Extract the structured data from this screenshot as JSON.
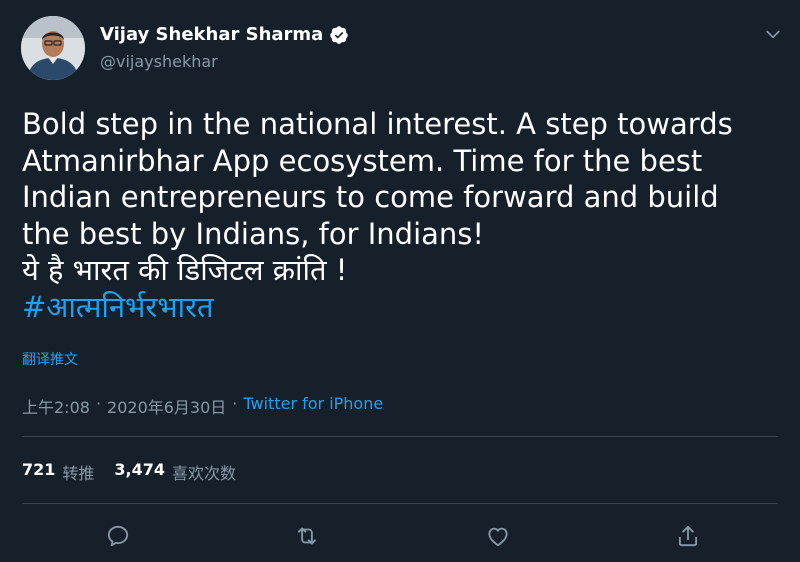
{
  "user": {
    "name": "Vijay Shekhar Sharma",
    "handle": "@vijayshekhar"
  },
  "tweet": {
    "lines": [
      "Bold step in the national interest. A step towards",
      "Atmanirbhar App ecosystem. Time for the best",
      "Indian entrepreneurs to come forward and build",
      "the best by Indians, for Indians!",
      "ये है भारत की डिजिटल क्रांति !"
    ],
    "hashtag": "#आत्मनिर्भरभारत",
    "translate_label": "翻译推文"
  },
  "meta": {
    "time": "上午2:08",
    "separator1": "·",
    "date": "2020年6月30日",
    "separator2": "·",
    "source": "Twitter for iPhone"
  },
  "stats": {
    "retweets_count": "721",
    "retweets_label": "转推",
    "likes_count": "3,474",
    "likes_label": "喜欢次数"
  },
  "colors": {
    "background": "#15202b",
    "accent": "#1da1f2",
    "secondary_text": "#8899a6",
    "divider": "#38444d"
  },
  "icons": {
    "verified": "verified-badge-icon",
    "caret": "chevron-down-icon",
    "reply": "reply-icon",
    "retweet": "retweet-icon",
    "like": "heart-icon",
    "share": "share-icon"
  }
}
